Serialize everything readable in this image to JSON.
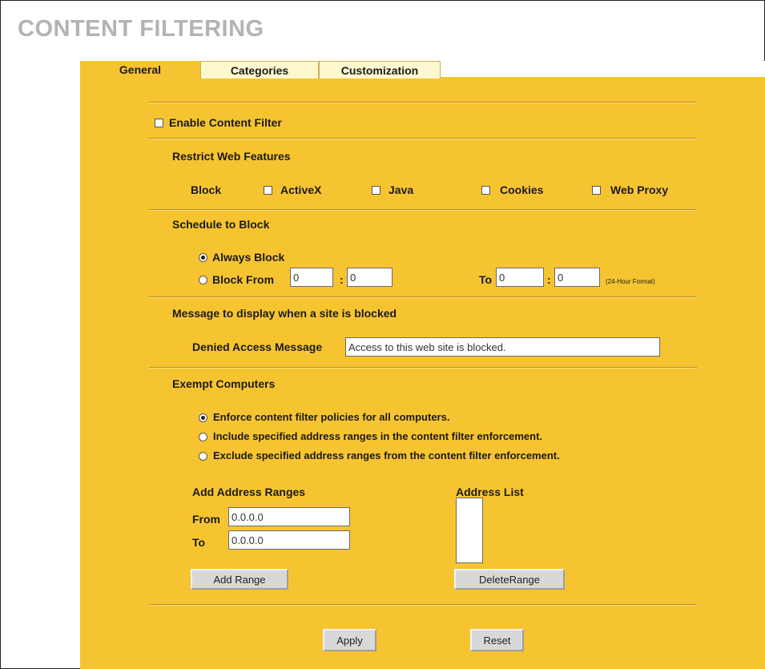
{
  "page_title": "CONTENT FILTERING",
  "tabs": {
    "general": "General",
    "categories": "Categories",
    "customization": "Customization"
  },
  "enable_filter": {
    "label": "Enable Content Filter",
    "checked": false
  },
  "restrict": {
    "heading": "Restrict Web Features",
    "block_label": "Block",
    "activex": "ActiveX",
    "java": "Java",
    "cookies": "Cookies",
    "web_proxy": "Web Proxy"
  },
  "schedule": {
    "heading": "Schedule to Block",
    "always_block": "Always Block",
    "block_from": "Block From",
    "from_hour": "0",
    "from_minute": "0",
    "colon": ":",
    "to_label": "To",
    "to_hour": "0",
    "to_minute": "0",
    "format_note": "(24-Hour Format)",
    "selected": "always"
  },
  "message": {
    "heading": "Message to display when a site is blocked",
    "denied_label": "Denied Access Message",
    "denied_value": "Access to this web site is blocked."
  },
  "exempt": {
    "heading": "Exempt Computers",
    "options": [
      "Enforce content filter policies for all computers.",
      "Include specified address ranges in the content filter enforcement.",
      "Exclude specified address ranges from the content filter enforcement."
    ],
    "selected_index": 0,
    "add_ranges_heading": "Add Address Ranges",
    "from_label": "From",
    "from_value": "0.0.0.0",
    "to_label": "To",
    "to_value": "0.0.0.0",
    "address_list_heading": "Address List",
    "add_range_button": "Add Range",
    "delete_range_button": "DeleteRange"
  },
  "footer": {
    "apply": "Apply",
    "reset": "Reset"
  },
  "colors": {
    "panel": "#f7c431",
    "tab_inactive": "#fff8cf",
    "title": "#b3b3b3"
  }
}
